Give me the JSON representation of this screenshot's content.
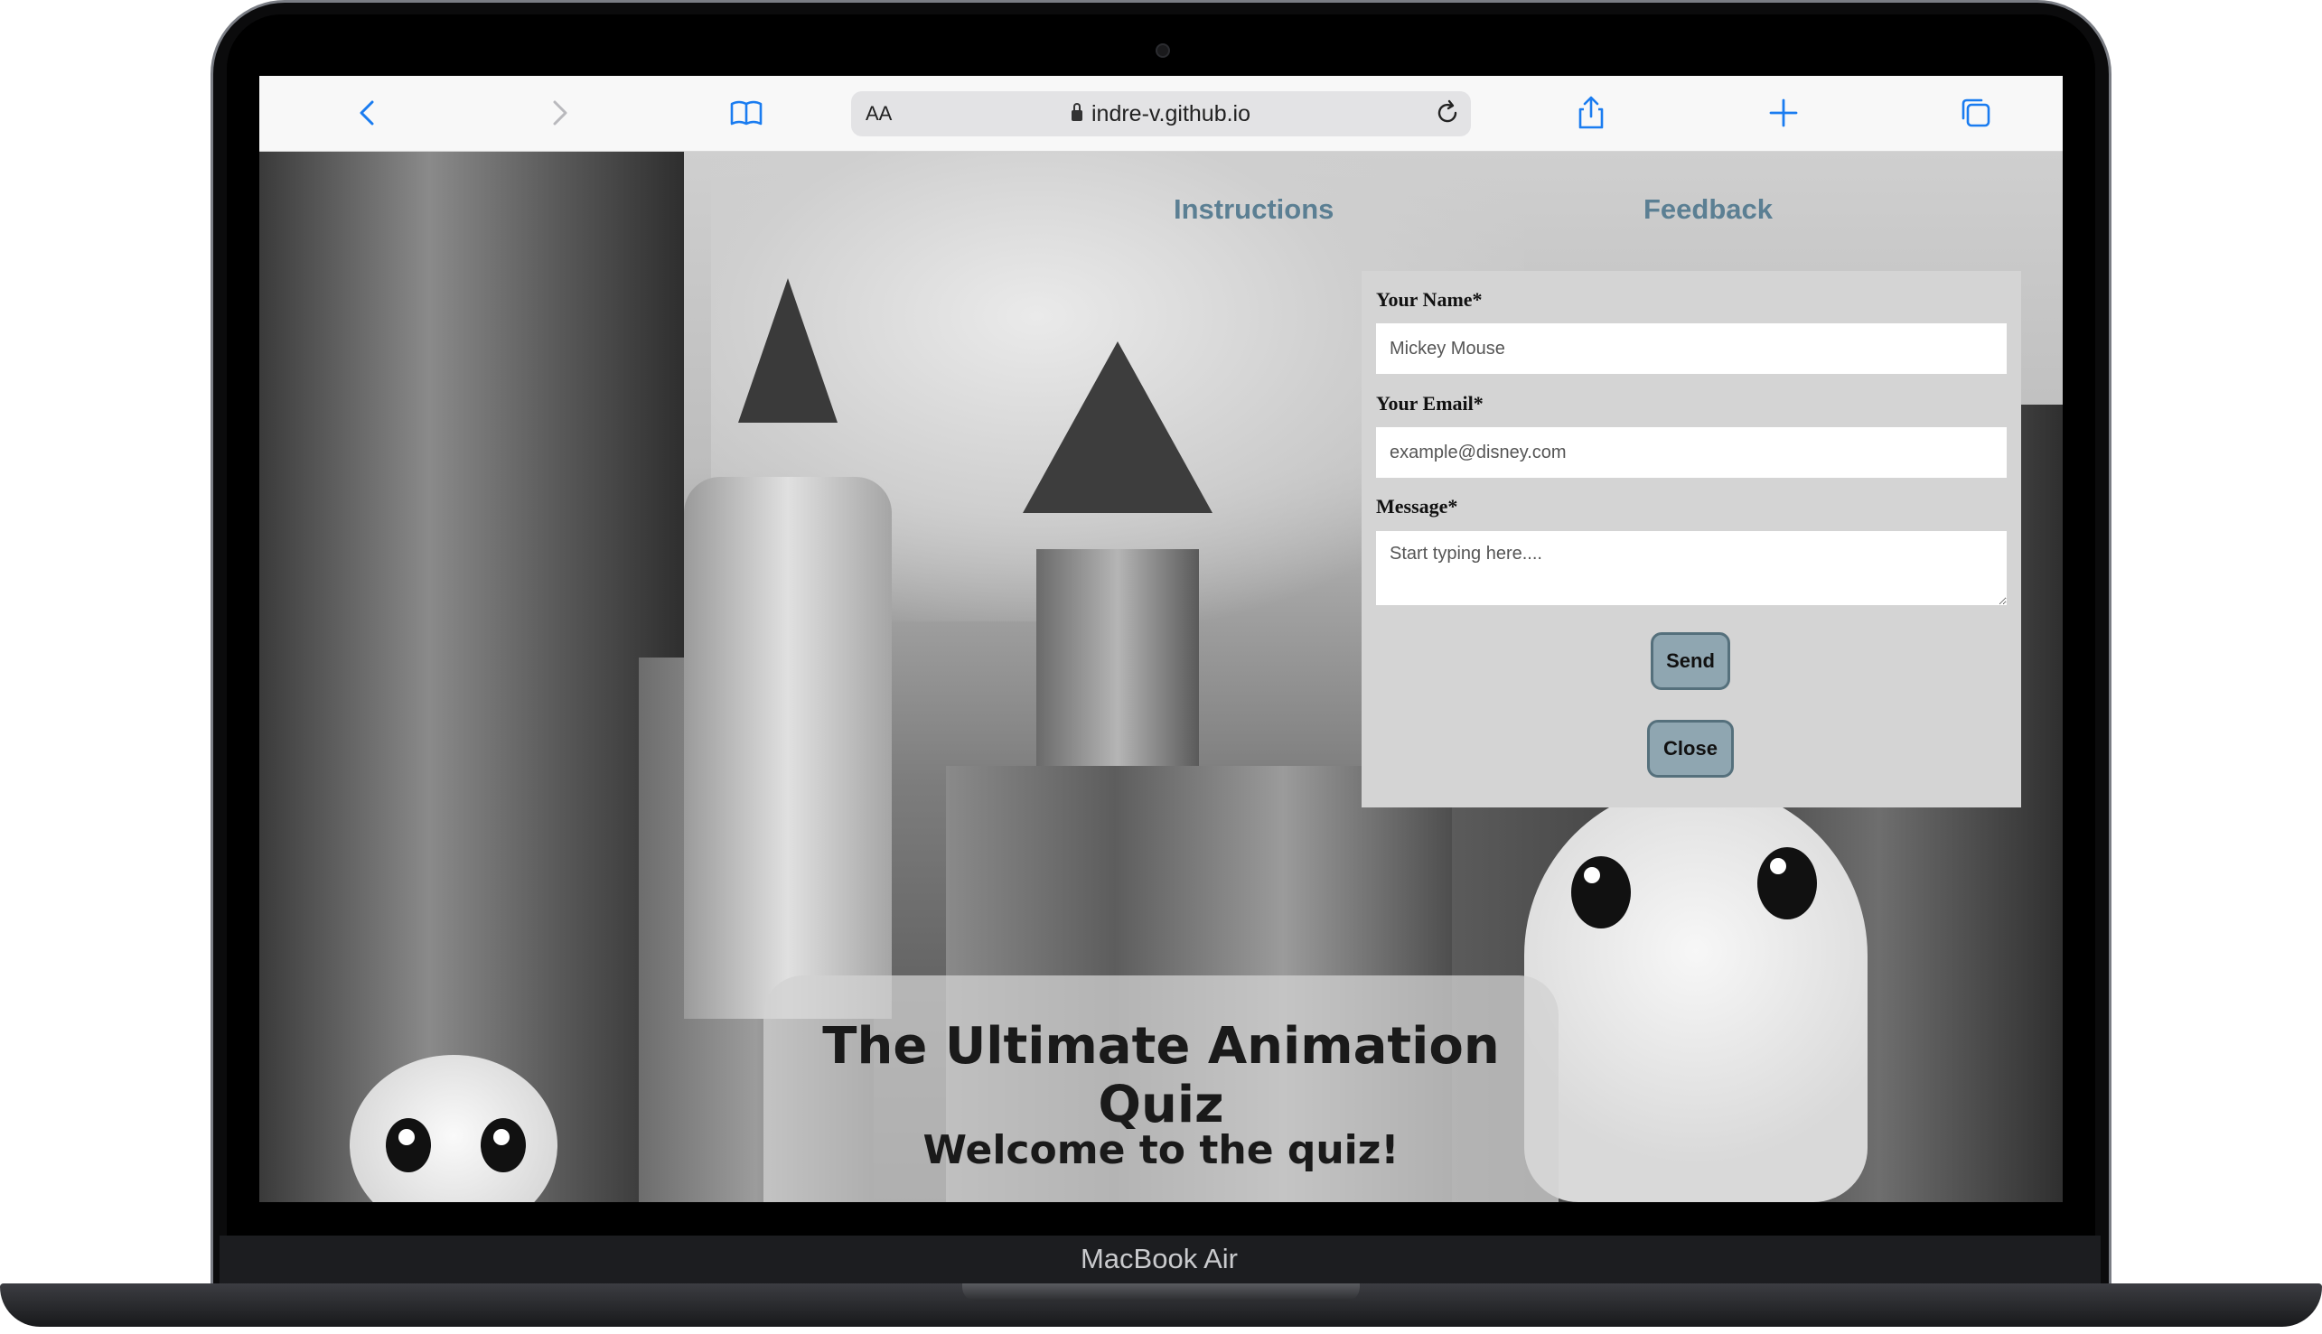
{
  "device": {
    "model_label": "MacBook Air"
  },
  "browser": {
    "text_size_button": "AA",
    "url": "indre-v.github.io",
    "icons": [
      "back-icon",
      "forward-icon",
      "bookmarks-icon",
      "reload-icon",
      "share-icon",
      "new-tab-icon",
      "tabs-icon"
    ]
  },
  "nav": {
    "instructions": "Instructions",
    "feedback": "Feedback"
  },
  "feedback_form": {
    "name_label": "Your Name*",
    "name_placeholder": "Mickey Mouse",
    "email_label": "Your Email*",
    "email_placeholder": "example@disney.com",
    "message_label": "Message*",
    "message_placeholder": "Start typing here....",
    "send_label": "Send",
    "close_label": "Close"
  },
  "hero": {
    "title": "The Ultimate Animation Quiz",
    "subtitle": "Welcome to the quiz!"
  },
  "colors": {
    "nav_link": "#5b7f93",
    "button_bg": "#8fa6b1",
    "button_border": "#55707c",
    "panel_bg": "#d4d4d4",
    "browser_accent": "#1a7cf0"
  }
}
